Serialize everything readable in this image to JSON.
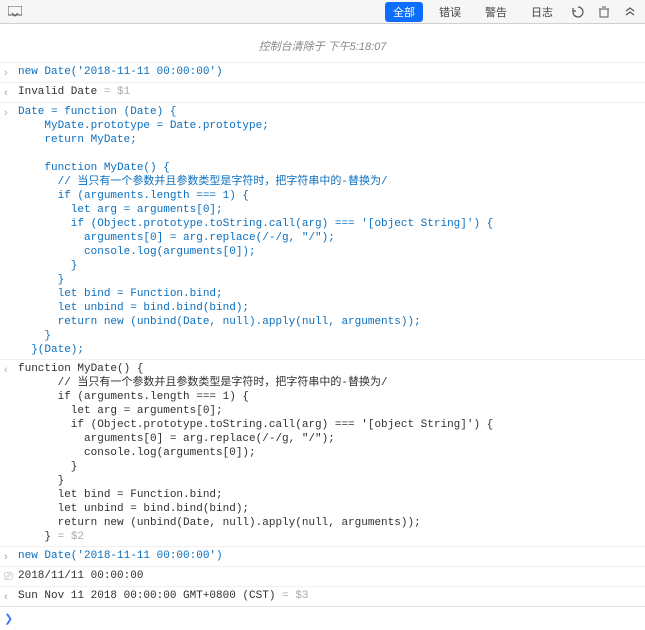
{
  "toolbar": {
    "tabs": {
      "all": "全部",
      "errors": "错误",
      "warnings": "警告",
      "logs": "日志"
    }
  },
  "clear_message": "控制台清除于 下午5:18:07",
  "entries": [
    {
      "kind": "cmd",
      "text": "new Date('2018-11-11 00:00:00')"
    },
    {
      "kind": "result",
      "text": "Invalid Date",
      "suffix": " = $1"
    },
    {
      "kind": "cmd",
      "text": "Date = function (Date) {\n    MyDate.prototype = Date.prototype;\n    return MyDate;\n\n    function MyDate() {\n      // 当只有一个参数并且参数类型是字符时，把字符串中的-替换为/\n      if (arguments.length === 1) {\n        let arg = arguments[0];\n        if (Object.prototype.toString.call(arg) === '[object String]') {\n          arguments[0] = arg.replace(/-/g, \"/\");\n          console.log(arguments[0]);\n        }\n      }\n      let bind = Function.bind;\n      let unbind = bind.bind(bind);\n      return new (unbind(Date, null).apply(null, arguments));\n    }\n  }(Date);"
    },
    {
      "kind": "result",
      "text": "function MyDate() {\n      // 当只有一个参数并且参数类型是字符时，把字符串中的-替换为/\n      if (arguments.length === 1) {\n        let arg = arguments[0];\n        if (Object.prototype.toString.call(arg) === '[object String]') {\n          arguments[0] = arg.replace(/-/g, \"/\");\n          console.log(arguments[0]);\n        }\n      }\n      let bind = Function.bind;\n      let unbind = bind.bind(bind);\n      return new (unbind(Date, null).apply(null, arguments));\n    }",
      "suffix": " = $2"
    },
    {
      "kind": "cmd",
      "text": "new Date('2018-11-11 00:00:00')"
    },
    {
      "kind": "log",
      "text": "2018/11/11 00:00:00"
    },
    {
      "kind": "result",
      "text": "Sun Nov 11 2018 00:00:00 GMT+0800 (CST)",
      "suffix": " = $3"
    }
  ],
  "prompt": {
    "value": ""
  }
}
